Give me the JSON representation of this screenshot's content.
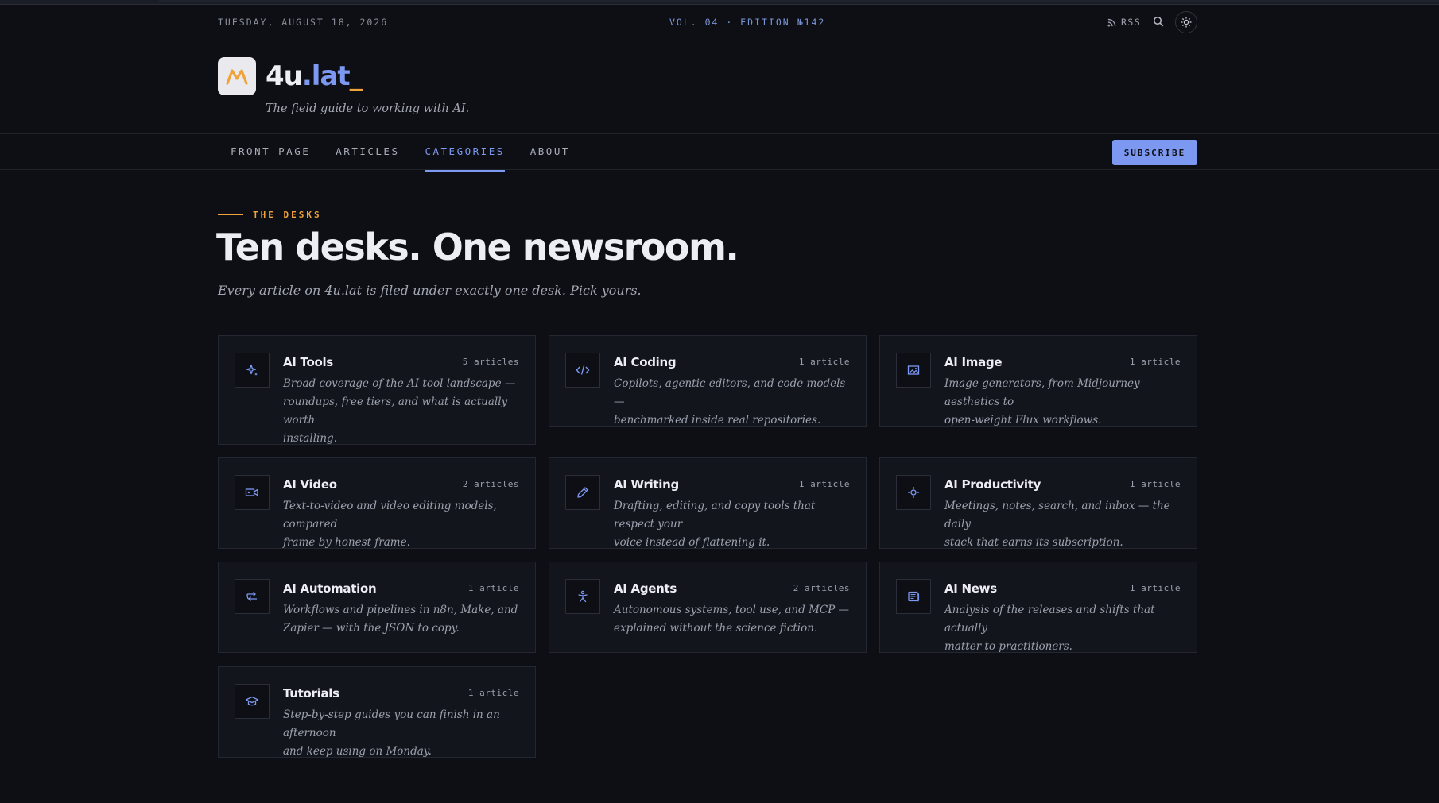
{
  "masthead": {
    "date": "TUESDAY, AUGUST 18, 2026",
    "edition": "VOL. 04 · EDITION №142",
    "rss_label": "RSS"
  },
  "brand": {
    "name_part1": "4u",
    "name_part2": ".lat",
    "name_part3": "_",
    "tagline": "The field guide to working with AI."
  },
  "nav": {
    "items": [
      {
        "label": "FRONT PAGE"
      },
      {
        "label": "ARTICLES"
      },
      {
        "label": "CATEGORIES"
      },
      {
        "label": "ABOUT"
      }
    ],
    "active": "CATEGORIES",
    "subscribe_label": "SUBSCRIBE"
  },
  "section": {
    "eyebrow": "THE DESKS",
    "heading": "Ten desks. One newsroom.",
    "intro": "Every article on 4u.lat is filed under exactly one desk. Pick yours."
  },
  "categories": [
    {
      "title": "AI Tools",
      "count": "5 articles",
      "icon": "sparkle-icon",
      "desc_lines": [
        "Broad coverage of the AI tool landscape —",
        "roundups, free tiers, and what is actually worth",
        "installing."
      ]
    },
    {
      "title": "AI Coding",
      "count": "1 article",
      "icon": "code-icon",
      "desc_lines": [
        "Copilots, agentic editors, and code models —",
        "benchmarked inside real repositories."
      ]
    },
    {
      "title": "AI Image",
      "count": "1 article",
      "icon": "image-icon",
      "desc_lines": [
        "Image generators, from Midjourney aesthetics to",
        "open-weight Flux workflows."
      ]
    },
    {
      "title": "AI Video",
      "count": "2 articles",
      "icon": "video-icon",
      "desc_lines": [
        "Text-to-video and video editing models, compared",
        "frame by honest frame."
      ]
    },
    {
      "title": "AI Writing",
      "count": "1 article",
      "icon": "pen-icon",
      "desc_lines": [
        "Drafting, editing, and copy tools that respect your",
        "voice instead of flattening it."
      ]
    },
    {
      "title": "AI Productivity",
      "count": "1 article",
      "icon": "target-icon",
      "desc_lines": [
        "Meetings, notes, search, and inbox — the daily",
        "stack that earns its subscription."
      ]
    },
    {
      "title": "AI Automation",
      "count": "1 article",
      "icon": "workflow-icon",
      "desc_lines": [
        "Workflows and pipelines in n8n, Make, and",
        "Zapier — with the JSON to copy."
      ]
    },
    {
      "title": "AI Agents",
      "count": "2 articles",
      "icon": "agent-icon",
      "desc_lines": [
        "Autonomous systems, tool use, and MCP —",
        "explained without the science fiction."
      ]
    },
    {
      "title": "AI News",
      "count": "1 article",
      "icon": "newspaper-icon",
      "desc_lines": [
        "Analysis of the releases and shifts that actually",
        "matter to practitioners."
      ]
    },
    {
      "title": "Tutorials",
      "count": "1 article",
      "icon": "graduation-cap-icon",
      "desc_lines": [
        "Step-by-step guides you can finish in an afternoon",
        "and keep using on Monday."
      ]
    }
  ],
  "colors": {
    "background": "#0d0f14",
    "card": "#12151c",
    "accent_blue": "#7d98f0",
    "accent_orange": "#f0a33a"
  }
}
